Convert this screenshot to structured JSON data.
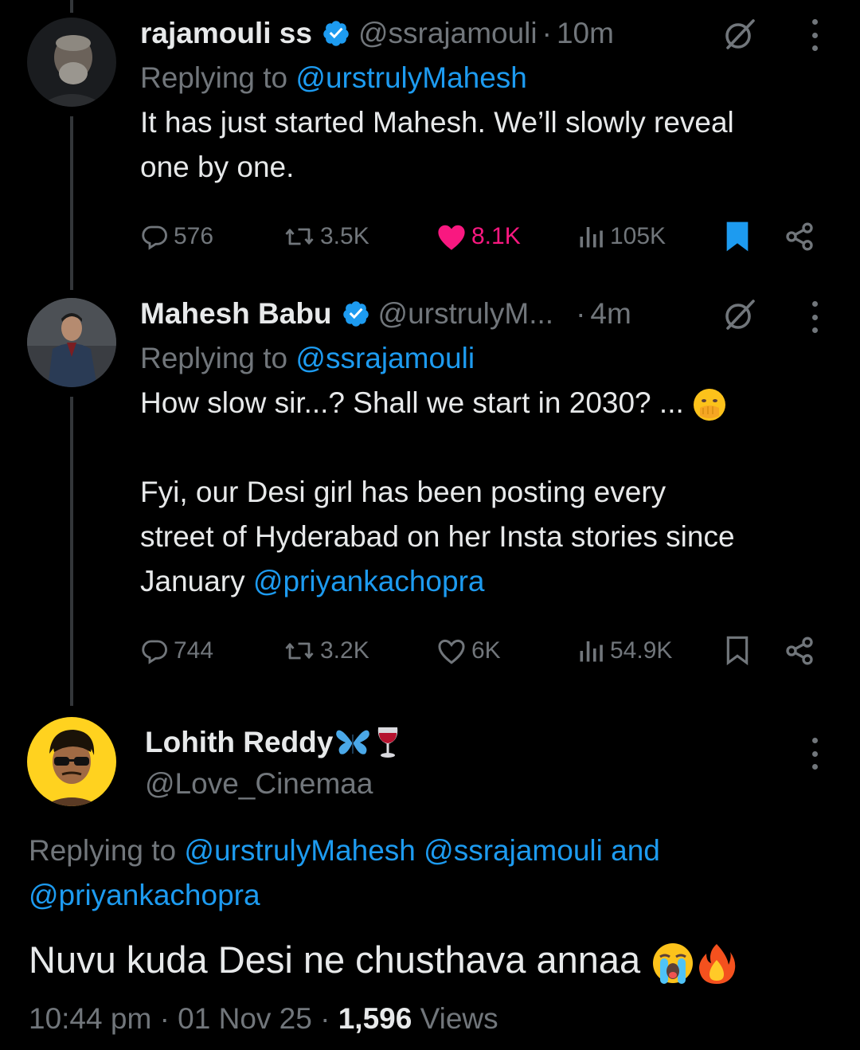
{
  "tweets": [
    {
      "name": "rajamouli ss",
      "handle": "@ssrajamouli",
      "time": "10m",
      "replying_prefix": "Replying to",
      "replying_mentions": "@urstrulyMahesh",
      "text": "It has just started Mahesh. We’ll slowly reveal\none by one.",
      "replies": "576",
      "retweets": "3.5K",
      "likes": "8.1K",
      "views": "105K",
      "liked": true,
      "bookmarked": true
    },
    {
      "name": "Mahesh Babu",
      "handle": "@urstrulyM...",
      "time": "4m",
      "replying_prefix": "Replying to",
      "replying_mentions": "@ssrajamouli",
      "text_line1": "How slow sir...? Shall we start in 2030? ...",
      "text_para2": "Fyi, our Desi girl has been posting every\nstreet of Hyderabad on her Insta stories since\nJanuary ",
      "text_mention": "@priyankachopra",
      "replies": "744",
      "retweets": "3.2K",
      "likes": "6K",
      "views": "54.9K",
      "liked": false,
      "bookmarked": false
    }
  ],
  "main": {
    "name": "Lohith Reddy",
    "handle": "@Love_Cinemaa",
    "replying_prefix": "Replying to",
    "replying_line1": "@urstrulyMahesh @ssrajamouli and",
    "replying_line2": "@priyankachopra",
    "text": "Nuvu kuda Desi ne chusthava annaa",
    "time": "10:44 pm",
    "date": "01 Nov 25",
    "views_count": "1,596",
    "views_label": "Views"
  },
  "colors": {
    "accent": "#1d9bf0",
    "muted": "#71767b",
    "like": "#f91880",
    "text": "#e7e9ea"
  }
}
